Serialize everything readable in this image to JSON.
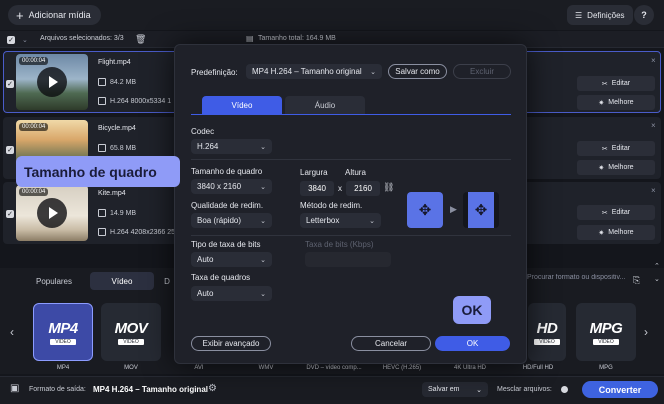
{
  "topbar": {
    "add_media_label": "Adicionar mídia",
    "settings_label": "Definições",
    "help_label": "?"
  },
  "filesbar": {
    "selected_label": "Arquivos selecionados: 3/3",
    "total_size_label": "Tamanho total: 164.9 MB"
  },
  "files": [
    {
      "timecode": "00:00:04",
      "name": "Flight.mp4",
      "size": "84.2 MB",
      "info": "H.264 8000x5334 1"
    },
    {
      "timecode": "00:00:04",
      "name": "Bicycle.mp4",
      "size": "65.8 MB",
      "info": ""
    },
    {
      "timecode": "00:00:04",
      "name": "Kite.mp4",
      "size": "14.9 MB",
      "info": "H.264 4208x2366 25"
    }
  ],
  "row_buttons": {
    "edit_label": "Editar",
    "enhance_label": "Melhore"
  },
  "modal": {
    "preset_label": "Predefinição:",
    "preset_value": "MP4 H.264 – Tamanho original",
    "save_as_label": "Salvar como",
    "delete_label": "Excluir",
    "tabs": [
      "Vídeo",
      "Áudio"
    ],
    "codec_label": "Codec",
    "codec_value": "H.264",
    "frame_size_label": "Tamanho de quadro",
    "frame_size_value": "3840 x 2160",
    "width_label": "Largura",
    "height_label": "Altura",
    "width_value": "3840",
    "height_value": "2160",
    "times": "x",
    "quality_label": "Qualidade de redim.",
    "quality_value": "Boa (rápido)",
    "resize_method_label": "Método de redim.",
    "resize_method_value": "Letterbox",
    "bitrate_type_label": "Tipo de taxa de bits",
    "bitrate_type_value": "Auto",
    "bitrate_label": "Taxa de bits (Kbps)",
    "framerate_label": "Taxa de quadros",
    "framerate_value": "Auto",
    "advanced_label": "Exibir avançado",
    "cancel_label": "Cancelar",
    "ok_label": "OK"
  },
  "tooltip": {
    "frame_size": "Tamanho de quadro",
    "ok": "OK"
  },
  "format_panel": {
    "tabs": [
      "Populares",
      "Vídeo",
      "D"
    ],
    "search_placeholder": "Procurar formato ou dispositiv...",
    "cards": [
      {
        "big": "MP4",
        "small": "VIDEO",
        "label": "MP4"
      },
      {
        "big": "MOV",
        "small": "VIDEO",
        "label": "MOV"
      },
      {
        "big": "",
        "small": "",
        "label": "AVI"
      },
      {
        "big": "",
        "small": "",
        "label": "WMV"
      },
      {
        "big": "",
        "small": "",
        "label": "DVD – vídeo comp..."
      },
      {
        "big": "",
        "small": "",
        "label": "HEVC (H.265)"
      },
      {
        "big": "",
        "small": "",
        "label": "4K Ultra HD"
      },
      {
        "big": "HD",
        "small": "VIDEO",
        "label": "HD/Full HD"
      },
      {
        "big": "MPG",
        "small": "VIDEO",
        "label": "MPG"
      }
    ]
  },
  "statusbar": {
    "output_label": "Formato de saída:",
    "output_value": "MP4 H.264 – Tamanho original",
    "save_to_label": "Salvar em",
    "merge_label": "Mesclar arquivos:",
    "convert_label": "Converter"
  }
}
